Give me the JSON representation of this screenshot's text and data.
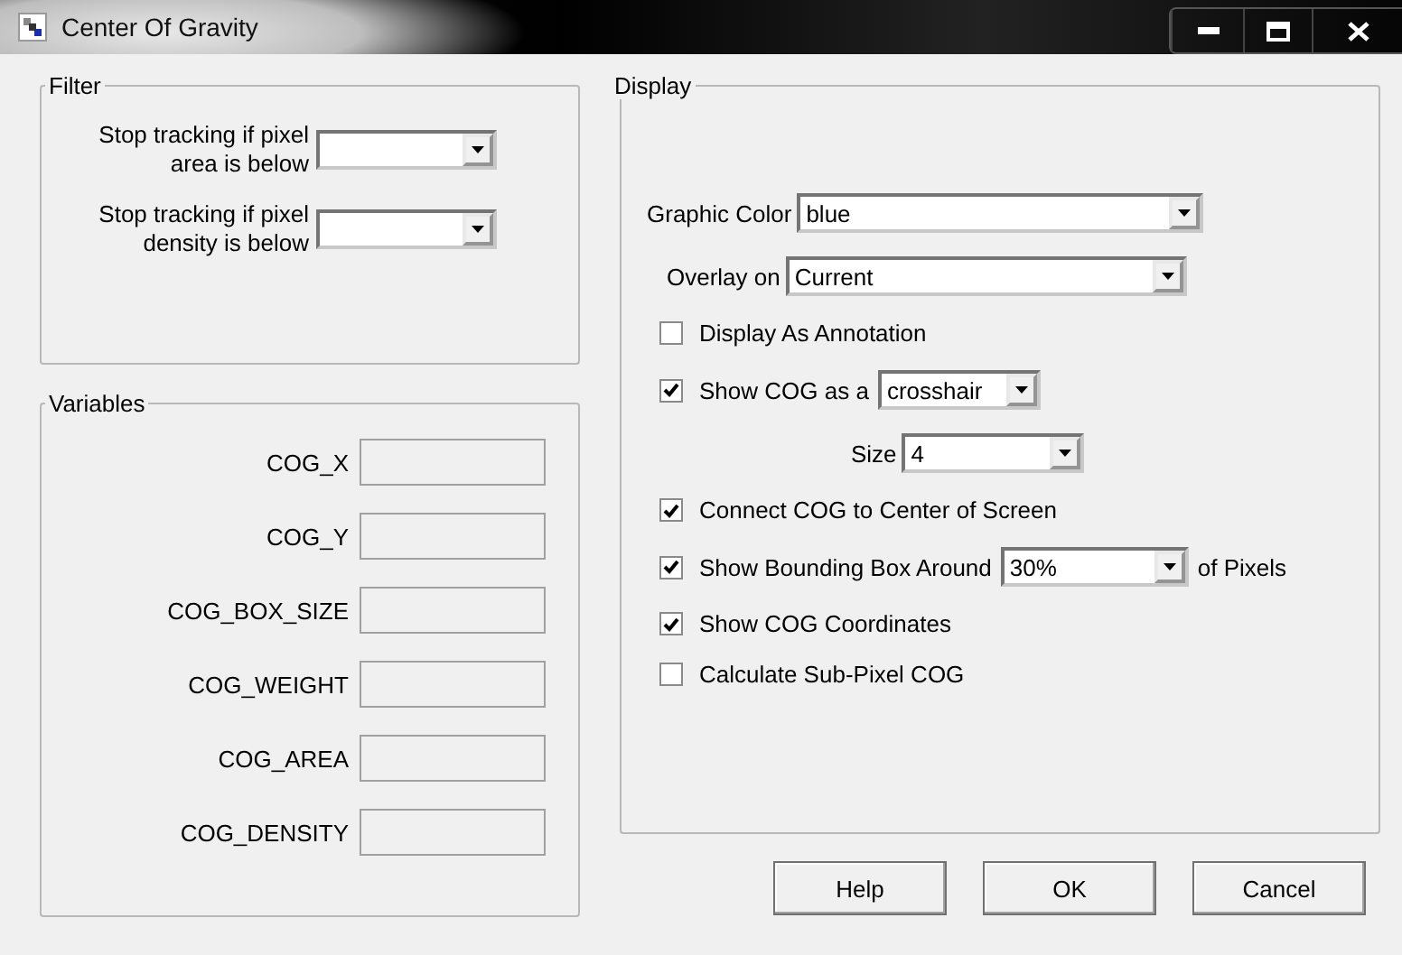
{
  "window": {
    "title": "Center Of Gravity"
  },
  "filter": {
    "title": "Filter",
    "rows": [
      {
        "label": "Stop tracking if pixel area is below",
        "value": ""
      },
      {
        "label": "Stop tracking if pixel density is below",
        "value": ""
      }
    ]
  },
  "variables": {
    "title": "Variables",
    "rows": [
      {
        "label": "COG_X",
        "value": ""
      },
      {
        "label": "COG_Y",
        "value": ""
      },
      {
        "label": "COG_BOX_SIZE",
        "value": ""
      },
      {
        "label": "COG_WEIGHT",
        "value": ""
      },
      {
        "label": "COG_AREA",
        "value": ""
      },
      {
        "label": "COG_DENSITY",
        "value": ""
      }
    ]
  },
  "display": {
    "title": "Display",
    "rows": [
      {
        "kind": "select",
        "label": "Graphic Color",
        "value": "blue"
      },
      {
        "kind": "select",
        "label": "Overlay on",
        "value": "Current"
      },
      {
        "kind": "checkbox",
        "label": "Display As Annotation",
        "checked": false
      },
      {
        "kind": "checkbox_select",
        "label": "Show COG as a",
        "checked": true,
        "value": "crosshair"
      },
      {
        "kind": "sub_select",
        "label": "Size",
        "value": "4"
      },
      {
        "kind": "checkbox",
        "label": "Connect COG to Center of Screen",
        "checked": true
      },
      {
        "kind": "checkbox_select",
        "label": "Show Bounding Box Around",
        "checked": true,
        "value": "30%",
        "suffix": "of Pixels"
      },
      {
        "kind": "checkbox",
        "label": "Show COG Coordinates",
        "checked": true
      },
      {
        "kind": "checkbox",
        "label": "Calculate Sub-Pixel COG",
        "checked": false
      }
    ]
  },
  "buttons": [
    "Help",
    "OK",
    "Cancel"
  ]
}
